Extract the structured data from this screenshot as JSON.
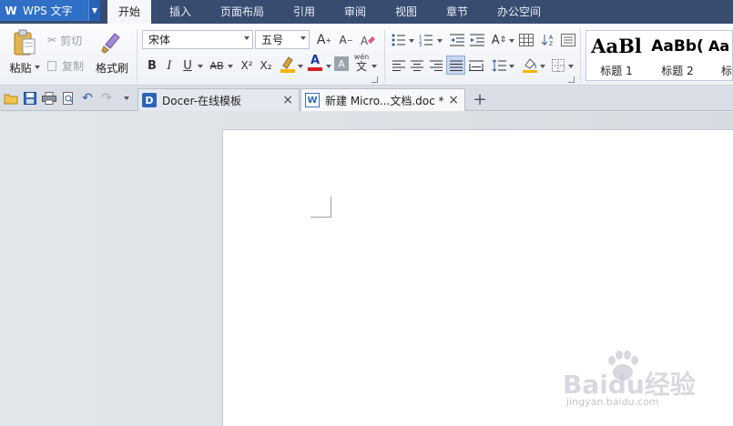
{
  "app": {
    "title": "WPS 文字",
    "logo_letter": "W"
  },
  "menu_tabs": [
    "开始",
    "插入",
    "页面布局",
    "引用",
    "审阅",
    "视图",
    "章节",
    "办公空间"
  ],
  "ribbon": {
    "paste_label": "粘贴",
    "cut_label": "剪切",
    "copy_label": "复制",
    "format_painter_label": "格式刷",
    "font_name": "宋体",
    "font_size": "五号",
    "bold_label": "B",
    "italic_label": "I",
    "underline_label": "U",
    "strikethrough_label": "AB",
    "superscript_label": "X²",
    "subscript_label": "X₂",
    "font_color_label": "A",
    "char_shading_label": "A",
    "phonetic_label": "文",
    "grow_font_label": "A",
    "shrink_font_label": "A",
    "char_spacing_label": "A"
  },
  "styles": [
    {
      "preview": "AaBl",
      "name": "标题 1"
    },
    {
      "preview": "AaBb(",
      "name": "标题 2"
    },
    {
      "preview": "Aa",
      "name": "标"
    }
  ],
  "tabs": [
    {
      "label": "Docer-在线模板",
      "icon": "D"
    },
    {
      "label": "新建 Micro...文档.doc *",
      "icon": "W"
    }
  ],
  "new_tab_label": "+",
  "close_label": "×",
  "watermark": {
    "text": "Baidu经验",
    "sub": "jingyan.baidu.com"
  },
  "colors": {
    "menubar": "#384c70",
    "app_button": "#2f6fc6",
    "highlight": "#f4b400",
    "font_color": "#d42020",
    "active_align": "#c7d7ef"
  }
}
